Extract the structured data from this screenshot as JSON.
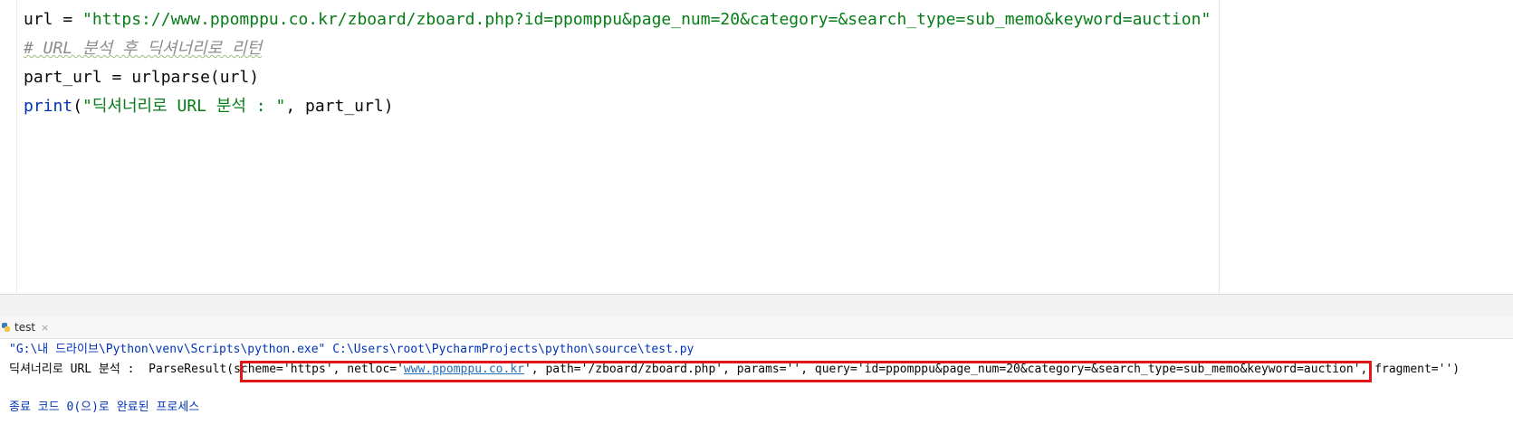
{
  "editor": {
    "lines": [
      {
        "a": "url = ",
        "b": "\"https://www.ppomppu.co.kr/zboard/zboard.php?id=ppomppu&page_num=20&category=&search_type=sub_memo&keyword=auction\""
      },
      {
        "comment": "# URL 분석 후 딕셔너리로 리턴"
      },
      {
        "a": "part_url = urlparse(url)"
      },
      {
        "fn": "print",
        "p1": "(",
        "str": "\"딕셔너리로 URL 분석 : \"",
        "rest": ", part_url)"
      }
    ]
  },
  "run_tab": {
    "label": "test",
    "close": "×",
    "icon": "python-file-icon"
  },
  "console": {
    "line1": "\"G:\\내 드라이브\\Python\\venv\\Scripts\\python.exe\" C:\\Users\\root\\PycharmProjects\\python\\source\\test.py",
    "line2_pre": "딕셔너리로 URL 분석 :  ParseResult(scheme='https', netloc='",
    "line2_link": "www.ppomppu.co.kr",
    "line2_post": "', path='/zboard/zboard.php', params='', query='id=ppomppu&page_num=20&category=&search_type=sub_memo&keyword=auction', fragment='')",
    "line3": "종료 코드 0(으)로 완료된 프로세스"
  },
  "colors": {
    "highlight": "#e01818",
    "string": "#067d17",
    "keyword": "#0033b3",
    "comment": "#8c8c8c"
  }
}
